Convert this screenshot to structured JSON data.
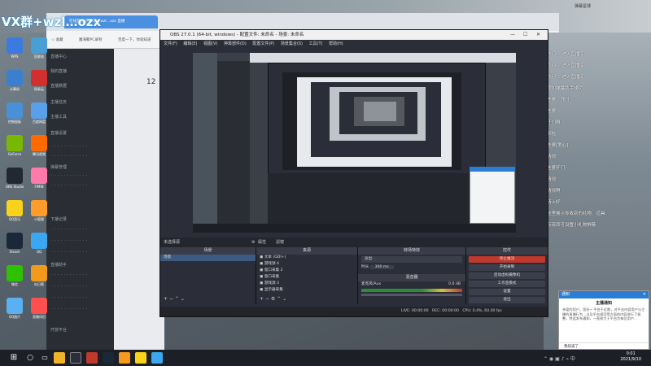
{
  "desktop_overlay": {
    "brand_text": "VX群+wzl…ozx"
  },
  "desktop_icons": [
    {
      "label": "WPS",
      "color": "#3b7be0"
    },
    {
      "label": "回收站",
      "color": "#4a9ed6"
    },
    {
      "label": "计算机",
      "color": "#3d7fcf"
    },
    {
      "label": "网易云",
      "color": "#d32f2f"
    },
    {
      "label": "控制面板",
      "color": "#4a90d9"
    },
    {
      "label": "百度网盘",
      "color": "#5aa0e8"
    },
    {
      "label": "GeForce",
      "color": "#76b900"
    },
    {
      "label": "腾讯视频",
      "color": "#ff6a00"
    },
    {
      "label": "OBS Studio",
      "color": "#222831"
    },
    {
      "label": "FIMIN",
      "color": "#ff7aa8"
    },
    {
      "label": "QQ音乐",
      "color": "#f9d21b"
    },
    {
      "label": "小狐狸",
      "color": "#ff9c2a"
    },
    {
      "label": "Steam",
      "color": "#1b2838"
    },
    {
      "label": "QQ",
      "color": "#3aa7f0"
    },
    {
      "label": "微信",
      "color": "#2dc100"
    },
    {
      "label": "向日葵",
      "color": "#f39a1d"
    },
    {
      "label": "QQ图片",
      "color": "#5ab0f0"
    },
    {
      "label": "直播伴侣",
      "color": "#ff4f4f"
    }
  ],
  "browser": {
    "tab_title": "在线直播间·VX群+wzl…ozx 直播",
    "bookmarks": [
      "☆ 收藏",
      "魔海聚PC录制",
      "百度一下，你就知道",
      "2019年上半年综合…"
    ]
  },
  "console": {
    "stats_value": "12",
    "sections": [
      "直播中心",
      "我的直播",
      "直播数据",
      "主播任务",
      "主播工具",
      "直播设置",
      "弹幕管理",
      "下播记录",
      "直播助手",
      "开放平台"
    ]
  },
  "obs": {
    "title": "OBS 27.0.1 (64-bit, windows) - 配置文件: 未命名 - 场景: 未命名",
    "menu": [
      "文件(F)",
      "编辑(E)",
      "视图(V)",
      "停靠部件(D)",
      "配置文件(P)",
      "场景集合(S)",
      "工具(T)",
      "帮助(H)"
    ],
    "scene_tab_label": "未选择源",
    "tab_properties": "属性",
    "tab_filters": "滤镜",
    "docks": {
      "scenes": {
        "header": "场景",
        "items": [
          "场景"
        ]
      },
      "sources": {
        "header": "来源",
        "items": [
          "文本 (GDI+)",
          "游戏源 4",
          "窗口采集 2",
          "窗口采集",
          "游戏源 3",
          "显示器采集"
        ]
      },
      "transitions": {
        "header": "转场特效",
        "type": "淡出",
        "duration_label": "时长",
        "duration_value": "300 ms",
        "mixer_header": "混音器",
        "mixer_track": "麦克风/Aux",
        "mixer_db": "0.0 dB"
      },
      "controls": {
        "header": "控件",
        "buttons": [
          "停止推流",
          "开始录制",
          "启动虚拟摄像机",
          "工作室模式",
          "设置",
          "退出"
        ]
      }
    },
    "status": {
      "live_time": "LIVE: 00:00:00",
      "rec_time": "REC: 00:00:00",
      "cpu": "CPU: 0.4%, 60.00 fps"
    }
  },
  "chat": {
    "header_note": "弹幕星球",
    "messages": [
      {
        "text": "欢迎 …进入直播间",
        "color": "white"
      },
      {
        "text": "欢迎 …进入直播间",
        "color": "white"
      },
      {
        "text": "欢迎 …进入直播间",
        "color": "white"
      },
      {
        "text": "添加弹幕助手成功",
        "color": "white"
      },
      {
        "text": "老婆，开门",
        "color": "white"
      },
      {
        "text": "老婆 ~",
        "color": "white"
      },
      {
        "text": "开门啊",
        "color": "white"
      },
      {
        "text": "来啦",
        "color": "white"
      },
      {
        "text": "老婆[爱心]",
        "color": "white"
      },
      {
        "text": "晴视",
        "color": "white"
      },
      {
        "text": "老婆开门",
        "color": "white"
      },
      {
        "text": "晴视",
        "color": "white"
      },
      {
        "text": "晴视啊",
        "color": "white"
      },
      {
        "text": "晴上好",
        "color": "white"
      },
      {
        "text": "这里展示你收到的礼物、道具",
        "color": "white"
      },
      {
        "text": "点亮即可设置小礼物屏蔽",
        "color": "white"
      }
    ]
  },
  "notice": {
    "header": "通知",
    "title": "主播通知",
    "body": "亲爱的用户，您好~ 平台于近期，对平台内容用户与主播的直播行为…以及平台规范等方面的内容进行了调整，特此发布通知，一直致力于平台为每位用户…",
    "footer": "我知道了"
  },
  "taskbar": {
    "time": "0:01",
    "date": "2021/9/10"
  }
}
